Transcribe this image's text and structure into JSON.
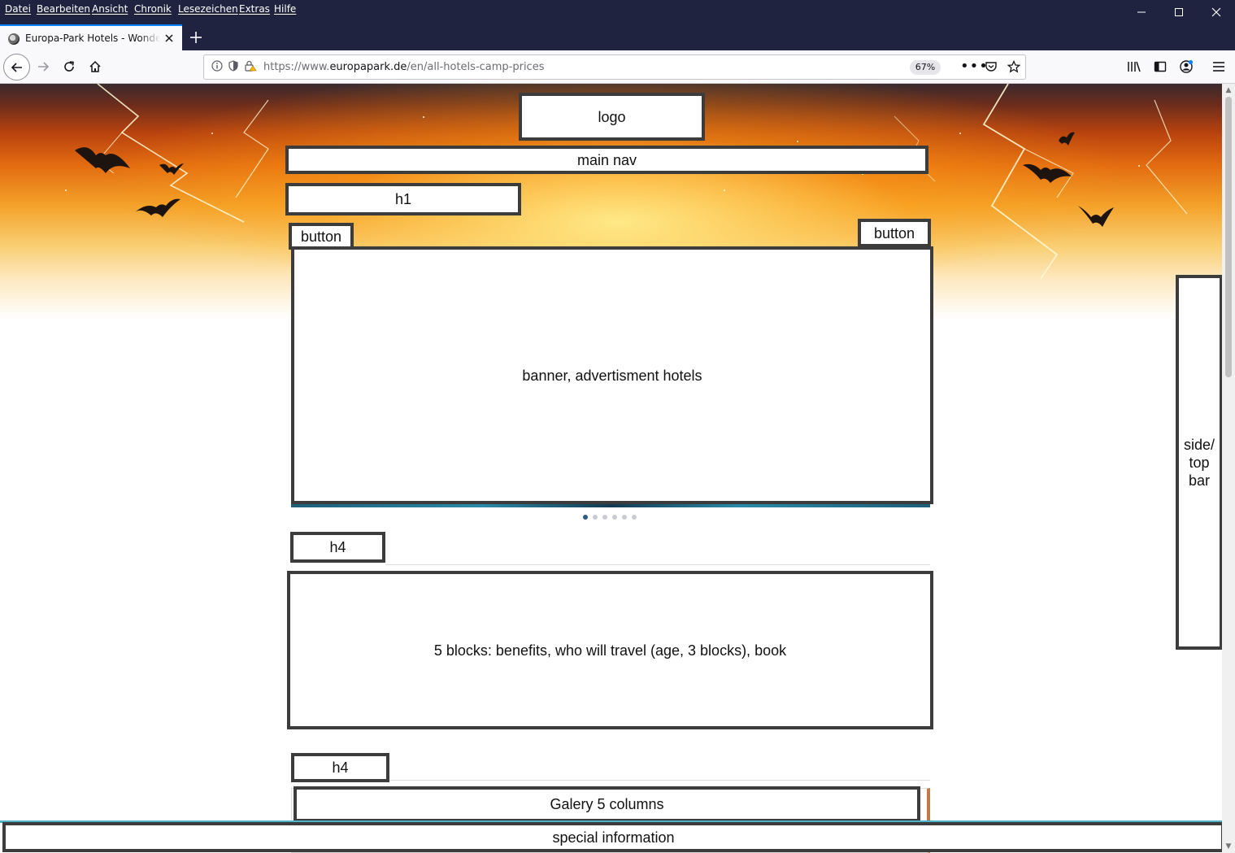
{
  "menubar": {
    "items": [
      "Datei",
      "Bearbeiten",
      "Ansicht",
      "Chronik",
      "Lesezeichen",
      "Extras",
      "Hilfe"
    ],
    "window_buttons": {
      "minimize": "—",
      "maximize": "☐",
      "close": "✕"
    }
  },
  "tabs": [
    {
      "title": "Europa-Park Hotels - Wonderful",
      "favicon": "europapark-favicon",
      "active": true
    }
  ],
  "toolbar": {
    "url_prefix": "https://www.",
    "url_domain": "europapark.de",
    "url_path": "/en/all-hotels-camp-prices",
    "zoom": "67%",
    "icons": [
      "back-icon",
      "forward-icon",
      "reload-icon",
      "home-icon",
      "info-icon",
      "shield-icon",
      "insecure-lock-icon",
      "more-icon",
      "pocket-icon",
      "bookmark-star-icon",
      "library-icon",
      "sidebar-icon",
      "account-icon",
      "hamburger-menu-icon"
    ]
  },
  "page": {
    "logo": "logo",
    "main_nav": "main nav",
    "h1": "h1",
    "button_left": "button",
    "button_right": "button",
    "banner": "banner, advertisment hotels",
    "carousel_dots": [
      true,
      false,
      false,
      false,
      false,
      false
    ],
    "h4_first": "h4",
    "blocks": "5 blocks: benefits, who will travel (age, 3 blocks), book",
    "h4_second": "h4",
    "gallery": "Galery 5 columns",
    "sidebar": "side/ top bar",
    "special_info": "special information"
  },
  "colors": {
    "chrome_dark": "#202340",
    "tab_accent": "#0a84ff",
    "wireframe_border": "#3c3c3c",
    "carousel_active": "#2a5a8c",
    "hero_orange": "#e36b10"
  }
}
